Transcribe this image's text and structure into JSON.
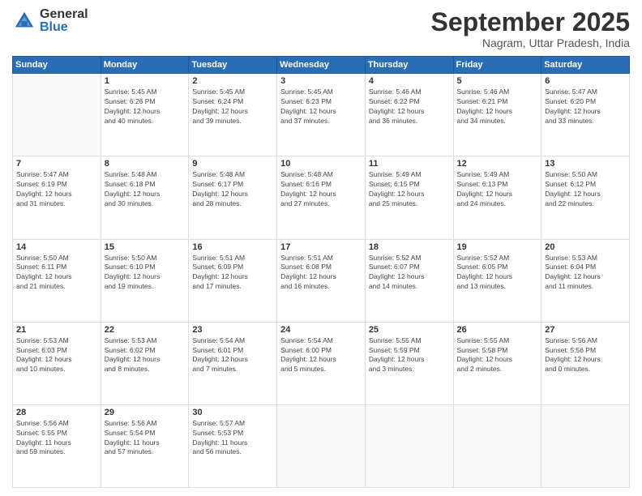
{
  "logo": {
    "general": "General",
    "blue": "Blue"
  },
  "header": {
    "month": "September 2025",
    "location": "Nagram, Uttar Pradesh, India"
  },
  "weekdays": [
    "Sunday",
    "Monday",
    "Tuesday",
    "Wednesday",
    "Thursday",
    "Friday",
    "Saturday"
  ],
  "weeks": [
    [
      {
        "day": null,
        "info": ""
      },
      {
        "day": "1",
        "info": "Sunrise: 5:45 AM\nSunset: 6:26 PM\nDaylight: 12 hours\nand 40 minutes."
      },
      {
        "day": "2",
        "info": "Sunrise: 5:45 AM\nSunset: 6:24 PM\nDaylight: 12 hours\nand 39 minutes."
      },
      {
        "day": "3",
        "info": "Sunrise: 5:45 AM\nSunset: 6:23 PM\nDaylight: 12 hours\nand 37 minutes."
      },
      {
        "day": "4",
        "info": "Sunrise: 5:46 AM\nSunset: 6:22 PM\nDaylight: 12 hours\nand 36 minutes."
      },
      {
        "day": "5",
        "info": "Sunrise: 5:46 AM\nSunset: 6:21 PM\nDaylight: 12 hours\nand 34 minutes."
      },
      {
        "day": "6",
        "info": "Sunrise: 5:47 AM\nSunset: 6:20 PM\nDaylight: 12 hours\nand 33 minutes."
      }
    ],
    [
      {
        "day": "7",
        "info": "Sunrise: 5:47 AM\nSunset: 6:19 PM\nDaylight: 12 hours\nand 31 minutes."
      },
      {
        "day": "8",
        "info": "Sunrise: 5:48 AM\nSunset: 6:18 PM\nDaylight: 12 hours\nand 30 minutes."
      },
      {
        "day": "9",
        "info": "Sunrise: 5:48 AM\nSunset: 6:17 PM\nDaylight: 12 hours\nand 28 minutes."
      },
      {
        "day": "10",
        "info": "Sunrise: 5:48 AM\nSunset: 6:16 PM\nDaylight: 12 hours\nand 27 minutes."
      },
      {
        "day": "11",
        "info": "Sunrise: 5:49 AM\nSunset: 6:15 PM\nDaylight: 12 hours\nand 25 minutes."
      },
      {
        "day": "12",
        "info": "Sunrise: 5:49 AM\nSunset: 6:13 PM\nDaylight: 12 hours\nand 24 minutes."
      },
      {
        "day": "13",
        "info": "Sunrise: 5:50 AM\nSunset: 6:12 PM\nDaylight: 12 hours\nand 22 minutes."
      }
    ],
    [
      {
        "day": "14",
        "info": "Sunrise: 5:50 AM\nSunset: 6:11 PM\nDaylight: 12 hours\nand 21 minutes."
      },
      {
        "day": "15",
        "info": "Sunrise: 5:50 AM\nSunset: 6:10 PM\nDaylight: 12 hours\nand 19 minutes."
      },
      {
        "day": "16",
        "info": "Sunrise: 5:51 AM\nSunset: 6:09 PM\nDaylight: 12 hours\nand 17 minutes."
      },
      {
        "day": "17",
        "info": "Sunrise: 5:51 AM\nSunset: 6:08 PM\nDaylight: 12 hours\nand 16 minutes."
      },
      {
        "day": "18",
        "info": "Sunrise: 5:52 AM\nSunset: 6:07 PM\nDaylight: 12 hours\nand 14 minutes."
      },
      {
        "day": "19",
        "info": "Sunrise: 5:52 AM\nSunset: 6:05 PM\nDaylight: 12 hours\nand 13 minutes."
      },
      {
        "day": "20",
        "info": "Sunrise: 5:53 AM\nSunset: 6:04 PM\nDaylight: 12 hours\nand 11 minutes."
      }
    ],
    [
      {
        "day": "21",
        "info": "Sunrise: 5:53 AM\nSunset: 6:03 PM\nDaylight: 12 hours\nand 10 minutes."
      },
      {
        "day": "22",
        "info": "Sunrise: 5:53 AM\nSunset: 6:02 PM\nDaylight: 12 hours\nand 8 minutes."
      },
      {
        "day": "23",
        "info": "Sunrise: 5:54 AM\nSunset: 6:01 PM\nDaylight: 12 hours\nand 7 minutes."
      },
      {
        "day": "24",
        "info": "Sunrise: 5:54 AM\nSunset: 6:00 PM\nDaylight: 12 hours\nand 5 minutes."
      },
      {
        "day": "25",
        "info": "Sunrise: 5:55 AM\nSunset: 5:59 PM\nDaylight: 12 hours\nand 3 minutes."
      },
      {
        "day": "26",
        "info": "Sunrise: 5:55 AM\nSunset: 5:58 PM\nDaylight: 12 hours\nand 2 minutes."
      },
      {
        "day": "27",
        "info": "Sunrise: 5:56 AM\nSunset: 5:56 PM\nDaylight: 12 hours\nand 0 minutes."
      }
    ],
    [
      {
        "day": "28",
        "info": "Sunrise: 5:56 AM\nSunset: 5:55 PM\nDaylight: 11 hours\nand 59 minutes."
      },
      {
        "day": "29",
        "info": "Sunrise: 5:56 AM\nSunset: 5:54 PM\nDaylight: 11 hours\nand 57 minutes."
      },
      {
        "day": "30",
        "info": "Sunrise: 5:57 AM\nSunset: 5:53 PM\nDaylight: 11 hours\nand 56 minutes."
      },
      {
        "day": null,
        "info": ""
      },
      {
        "day": null,
        "info": ""
      },
      {
        "day": null,
        "info": ""
      },
      {
        "day": null,
        "info": ""
      }
    ]
  ]
}
